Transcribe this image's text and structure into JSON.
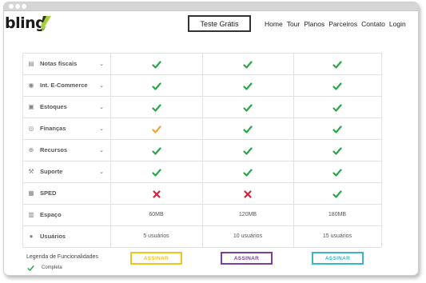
{
  "brand": {
    "name": "bling",
    "accent": "#a6ce39"
  },
  "header": {
    "trial_label": "Teste Grátis",
    "nav": [
      "Home",
      "Tour",
      "Planos",
      "Parceiros",
      "Contato",
      "Login"
    ]
  },
  "rows": [
    {
      "label": "Notas fiscais",
      "icon": "invoice-icon",
      "expandable": true,
      "plans": [
        "check-green",
        "check-green",
        "check-green"
      ]
    },
    {
      "label": "Int. E-Commerce",
      "icon": "cart-icon",
      "expandable": true,
      "plans": [
        "check-green",
        "check-green",
        "check-green"
      ]
    },
    {
      "label": "Estoques",
      "icon": "box-icon",
      "expandable": true,
      "plans": [
        "check-green",
        "check-green",
        "check-green"
      ]
    },
    {
      "label": "Finanças",
      "icon": "coin-icon",
      "expandable": true,
      "plans": [
        "check-orange",
        "check-green",
        "check-green"
      ]
    },
    {
      "label": "Recursos",
      "icon": "resources-icon",
      "expandable": true,
      "plans": [
        "check-green",
        "check-green",
        "check-green"
      ]
    },
    {
      "label": "Suporte",
      "icon": "wrench-icon",
      "expandable": true,
      "plans": [
        "check-green",
        "check-green",
        "check-green"
      ]
    },
    {
      "label": "SPED",
      "icon": "document-icon",
      "expandable": false,
      "plans": [
        "cross-red",
        "cross-red",
        "check-green"
      ]
    },
    {
      "label": "Espaço",
      "icon": "storage-icon",
      "expandable": false,
      "values": [
        "60MB",
        "120MB",
        "180MB"
      ]
    },
    {
      "label": "Usuários",
      "icon": "user-icon",
      "expandable": false,
      "values": [
        "5 usuários",
        "10 usuários",
        "15 usuários"
      ]
    }
  ],
  "legend": {
    "title": "Legenda de Funcionalidades",
    "complete_label": "Completa"
  },
  "plans": [
    {
      "button_label": "ASSINAR",
      "color": "#f0c419"
    },
    {
      "button_label": "ASSINAR",
      "color": "#7a3fa0"
    },
    {
      "button_label": "ASSINAR",
      "color": "#39b6c8"
    }
  ],
  "colors": {
    "check_green": "#27a845",
    "check_orange": "#f0a13a",
    "cross_red": "#d9203a",
    "grid_line": "#e2e2e2"
  }
}
